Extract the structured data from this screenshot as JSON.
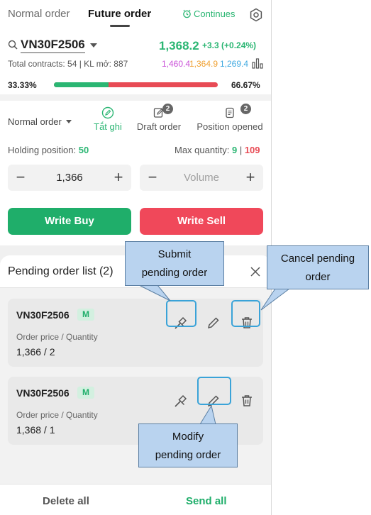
{
  "tabs": {
    "normal": "Normal order",
    "future": "Future order",
    "continues": "Continues"
  },
  "quote": {
    "symbol": "VN30F2506",
    "price": "1,368.2",
    "change": "+3.3 (+0.24%)",
    "contracts": "Total contracts: 54 | KL mở: 887",
    "level1": "1,460.4",
    "level2": "1,364.9",
    "level3": "1,269.4",
    "buy_ratio_text": "33.33%",
    "sell_ratio_text": "66.67%",
    "buy_ratio": 0.3333
  },
  "order": {
    "type": "Normal order",
    "mode_ghi": "Tắt ghi",
    "mode_draft": "Draft order",
    "draft_count": "2",
    "mode_positions": "Position opened",
    "positions_count": "2",
    "holding_label": "Holding position:",
    "holding_value": "50",
    "max_label": "Max quantity:",
    "max_buy": "9",
    "max_sep": "|",
    "max_sell": "109",
    "price_value": "1,366",
    "volume_placeholder": "Volume",
    "minus": "−",
    "plus": "+",
    "buy_label": "Write Buy",
    "sell_label": "Write Sell"
  },
  "pending": {
    "title": "Pending order list (2)",
    "orders": [
      {
        "symbol": "VN30F2506",
        "badge": "M",
        "label": "Order price / Quantity",
        "value": "1,366 / 2"
      },
      {
        "symbol": "VN30F2506",
        "badge": "M",
        "label": "Order price / Quantity",
        "value": "1,368 / 1"
      }
    ],
    "delete_all": "Delete all",
    "send_all": "Send all"
  },
  "callouts": {
    "submit": [
      "Submit",
      "pending order"
    ],
    "cancel": [
      "Cancel pending",
      "order"
    ],
    "modify": [
      "Modify",
      "pending order"
    ]
  },
  "colors": {
    "green": "#1fae6a",
    "red": "#f0485a",
    "callout": "#b9d3ef",
    "highlight": "#3aa3d8"
  }
}
